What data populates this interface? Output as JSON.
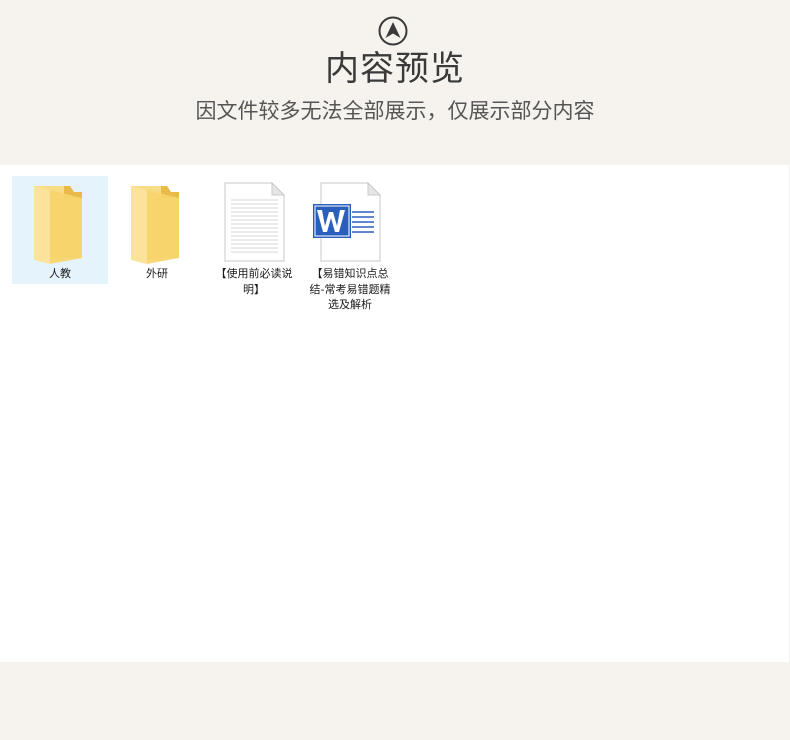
{
  "header": {
    "title": "内容预览",
    "subtitle": "因文件较多无法全部展示，仅展示部分内容",
    "up_icon": "arrow-up-circle-icon"
  },
  "files": [
    {
      "name": "人教",
      "type": "folder",
      "icon": "folder-icon",
      "selected": true
    },
    {
      "name": "外研",
      "type": "folder",
      "icon": "folder-icon",
      "selected": false
    },
    {
      "name": "【使用前必读说明】",
      "type": "text-document",
      "icon": "text-document-icon",
      "selected": false
    },
    {
      "name": "【易错知识点总结-常考易错题精选及解析",
      "type": "word-document",
      "icon": "word-document-icon",
      "selected": false
    }
  ],
  "colors": {
    "background": "#f6f3ee",
    "content": "#ffffff",
    "selection": "#e5f3fd",
    "folder": "#f7d774",
    "word_blue": "#2b5fbd"
  }
}
